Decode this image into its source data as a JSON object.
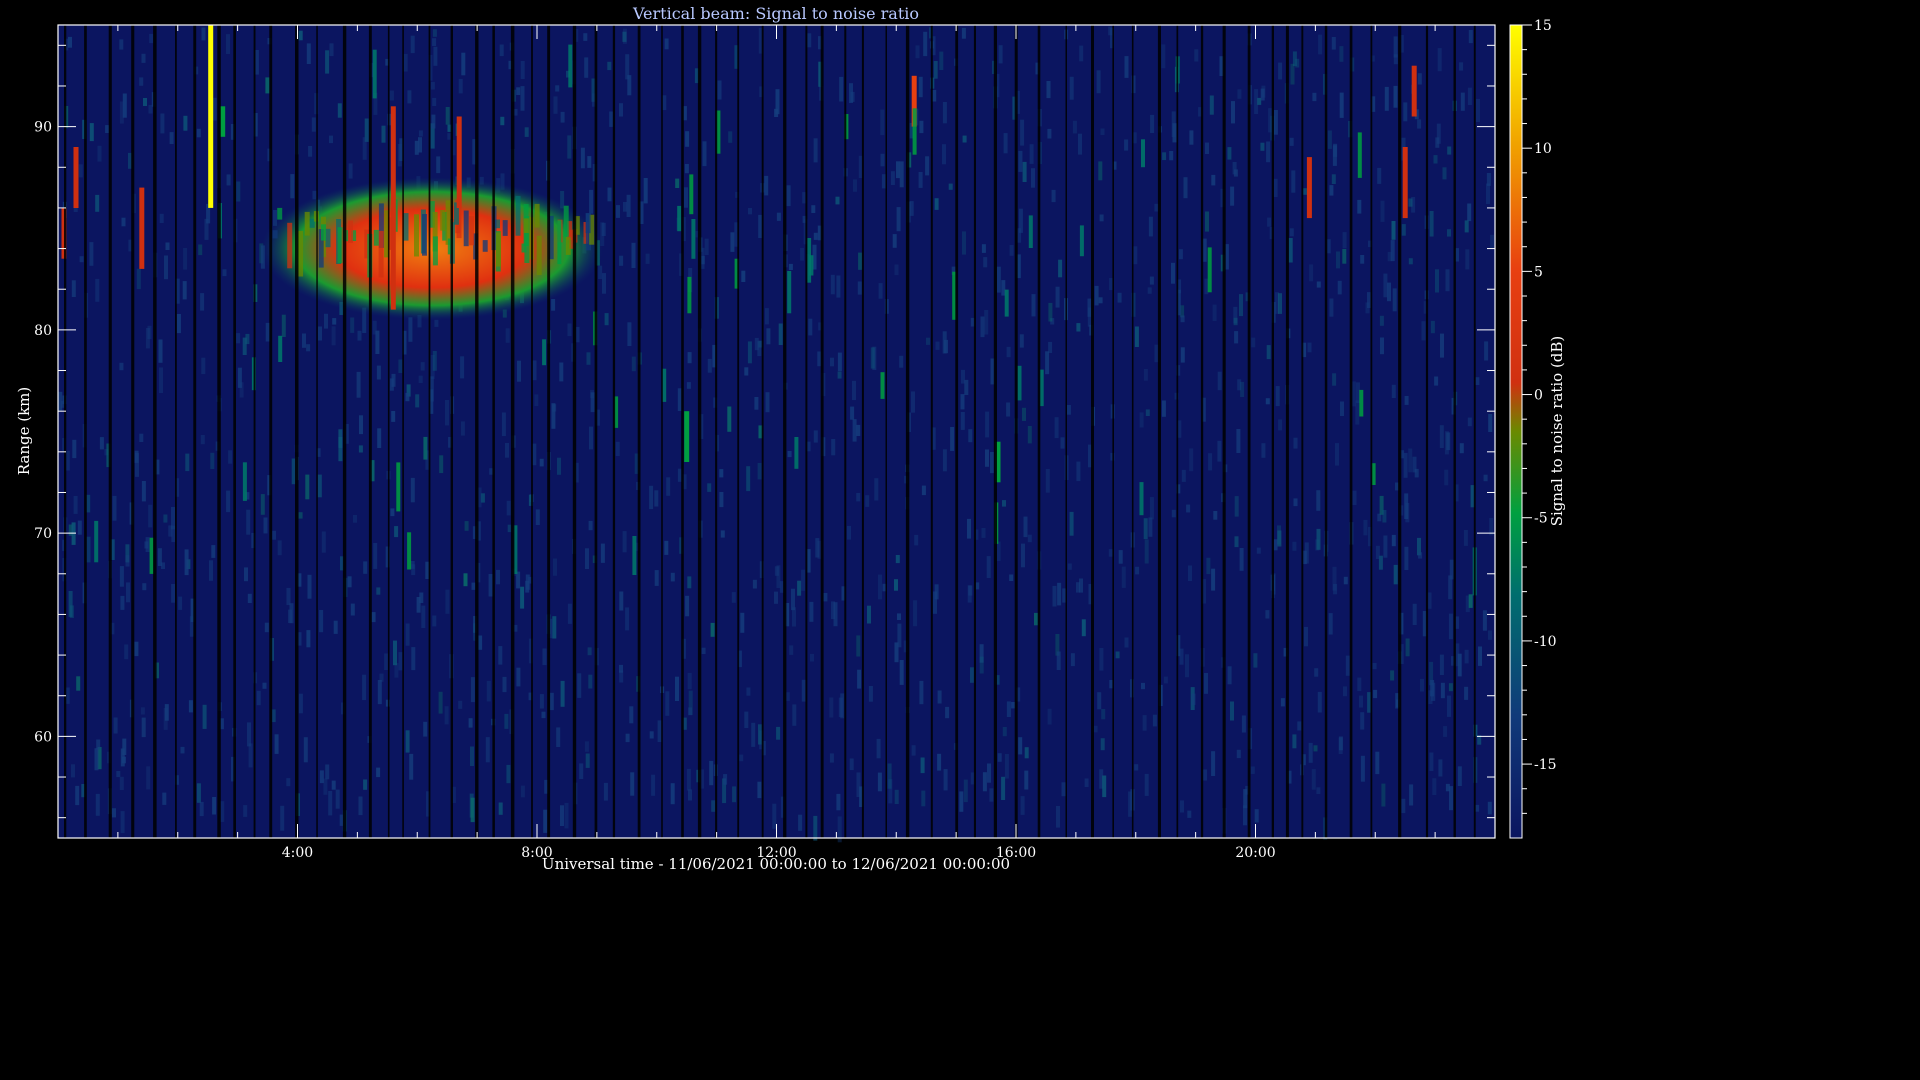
{
  "chart_data": {
    "type": "heatmap",
    "title": "Vertical beam: Signal to noise ratio",
    "xlabel": "Universal time - 11/06/2021 00:00:00 to 12/06/2021 00:00:00",
    "ylabel": "Range (km)",
    "colorbar_label": "Signal to noise ratio (dB)",
    "xlim_hours": [
      0,
      24
    ],
    "ylim_km": [
      55,
      95
    ],
    "clim_db": [
      -18,
      15
    ],
    "x_ticks": [
      {
        "hours": 4,
        "label": "4:00"
      },
      {
        "hours": 8,
        "label": "8:00"
      },
      {
        "hours": 12,
        "label": "12:00"
      },
      {
        "hours": 16,
        "label": "16:00"
      },
      {
        "hours": 20,
        "label": "20:00"
      }
    ],
    "y_ticks": [
      {
        "km": 60,
        "label": "60"
      },
      {
        "km": 70,
        "label": "70"
      },
      {
        "km": 80,
        "label": "80"
      },
      {
        "km": 90,
        "label": "90"
      }
    ],
    "colorbar_ticks": [
      {
        "db": 15,
        "label": "15"
      },
      {
        "db": 10,
        "label": "10"
      },
      {
        "db": 5,
        "label": "5"
      },
      {
        "db": 0,
        "label": "0"
      },
      {
        "db": -5,
        "label": "-5"
      },
      {
        "db": -10,
        "label": "-10"
      },
      {
        "db": -15,
        "label": "-15"
      }
    ],
    "background_snr_db": -15,
    "colormap": [
      "#0b1560",
      "#103a7a",
      "#006e6e",
      "#00a040",
      "#6a8a00",
      "#d03010",
      "#e84010",
      "#f0a000",
      "#ffff00"
    ],
    "features": [
      {
        "name": "main echo layer",
        "t_start": 3.4,
        "t_end": 9.1,
        "km_low": 80.5,
        "km_high": 87.5,
        "peak_db": 4
      },
      {
        "name": "echo streak",
        "t": 0.1,
        "km_low": 83.5,
        "km_high": 86,
        "db": 2
      },
      {
        "name": "echo streak",
        "t": 0.3,
        "km_low": 86,
        "km_high": 89,
        "db": 1
      },
      {
        "name": "echo streak",
        "t": 1.4,
        "km_low": 83,
        "km_high": 87,
        "db": 2
      },
      {
        "name": "echo streak",
        "t": 2.55,
        "km_low": 86,
        "km_high": 95,
        "db": 14
      },
      {
        "name": "echo streak",
        "t": 2.75,
        "km_low": 89.5,
        "km_high": 91,
        "db": -6
      },
      {
        "name": "echo streak",
        "t": 5.6,
        "km_low": 81,
        "km_high": 91,
        "db": 2
      },
      {
        "name": "echo streak",
        "t": 6.7,
        "km_low": 86,
        "km_high": 90.5,
        "db": 2
      },
      {
        "name": "echo streak",
        "t": 10.5,
        "km_low": 73.5,
        "km_high": 76,
        "db": -6
      },
      {
        "name": "echo streak",
        "t": 14.3,
        "km_low": 90,
        "km_high": 92.5,
        "db": 4
      },
      {
        "name": "echo streak",
        "t": 15.7,
        "km_low": 72.5,
        "km_high": 74.5,
        "db": -6
      },
      {
        "name": "echo streak",
        "t": 20.9,
        "km_low": 85.5,
        "km_high": 88.5,
        "db": 2
      },
      {
        "name": "echo streak",
        "t": 22.5,
        "km_low": 85.5,
        "km_high": 89,
        "db": 3
      },
      {
        "name": "echo streak",
        "t": 22.65,
        "km_low": 90.5,
        "km_high": 93,
        "db": 2
      }
    ]
  }
}
